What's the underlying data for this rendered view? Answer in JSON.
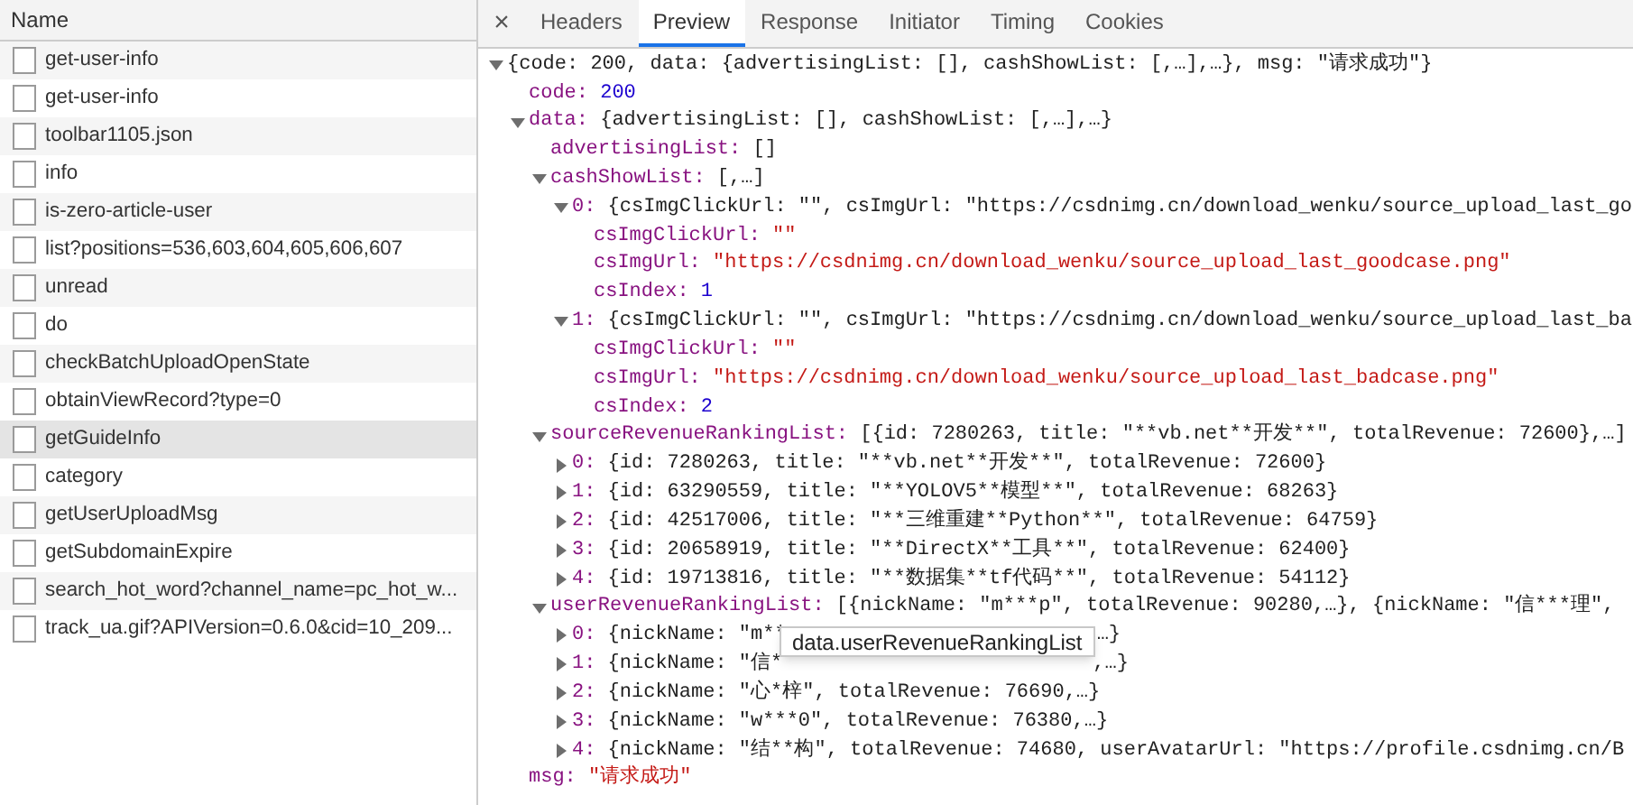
{
  "requests": {
    "column": "Name",
    "rows": [
      {
        "name": "get-user-info",
        "selected": false
      },
      {
        "name": "get-user-info",
        "selected": false
      },
      {
        "name": "toolbar1105.json",
        "selected": false
      },
      {
        "name": "info",
        "selected": false
      },
      {
        "name": "is-zero-article-user",
        "selected": false
      },
      {
        "name": "list?positions=536,603,604,605,606,607",
        "selected": false
      },
      {
        "name": "unread",
        "selected": false
      },
      {
        "name": "do",
        "selected": false
      },
      {
        "name": "checkBatchUploadOpenState",
        "selected": false
      },
      {
        "name": "obtainViewRecord?type=0",
        "selected": false
      },
      {
        "name": "getGuideInfo",
        "selected": true
      },
      {
        "name": "category",
        "selected": false
      },
      {
        "name": "getUserUploadMsg",
        "selected": false
      },
      {
        "name": "getSubdomainExpire",
        "selected": false
      },
      {
        "name": "search_hot_word?channel_name=pc_hot_w...",
        "selected": false
      },
      {
        "name": "track_ua.gif?APIVersion=0.6.0&cid=10_209...",
        "selected": false
      }
    ]
  },
  "close": "×",
  "tabs": [
    {
      "label": "Headers",
      "selected": false
    },
    {
      "label": "Preview",
      "selected": true
    },
    {
      "label": "Response",
      "selected": false
    },
    {
      "label": "Initiator",
      "selected": false
    },
    {
      "label": "Timing",
      "selected": false
    },
    {
      "label": "Cookies",
      "selected": false
    }
  ],
  "preview": {
    "tree": [
      {
        "kind": "object",
        "value": "{code: 200, data: {advertisingList: [], cashShowList: [,…],…}, msg: \"请求成功\"}",
        "expanded": true,
        "children": [
          {
            "key": "code:",
            "kind": "number",
            "value": "200"
          },
          {
            "key": "data:",
            "kind": "object",
            "value": "{advertisingList: [], cashShowList: [,…],…}",
            "expanded": true,
            "children": [
              {
                "key": "advertisingList:",
                "kind": "object",
                "value": "[]"
              },
              {
                "key": "cashShowList:",
                "kind": "object",
                "value": "[,…]",
                "expanded": true,
                "children": [
                  {
                    "key": "0:",
                    "kind": "object",
                    "value": "{csImgClickUrl: \"\", csImgUrl: \"https://csdnimg.cn/download_wenku/source_upload_last_go",
                    "expanded": true,
                    "children": [
                      {
                        "key": "csImgClickUrl:",
                        "kind": "string",
                        "value": "\"\""
                      },
                      {
                        "key": "csImgUrl:",
                        "kind": "string",
                        "value": "\"https://csdnimg.cn/download_wenku/source_upload_last_goodcase.png\""
                      },
                      {
                        "key": "csIndex:",
                        "kind": "number",
                        "value": "1"
                      }
                    ]
                  },
                  {
                    "key": "1:",
                    "kind": "object",
                    "value": "{csImgClickUrl: \"\", csImgUrl: \"https://csdnimg.cn/download_wenku/source_upload_last_ba",
                    "expanded": true,
                    "children": [
                      {
                        "key": "csImgClickUrl:",
                        "kind": "string",
                        "value": "\"\""
                      },
                      {
                        "key": "csImgUrl:",
                        "kind": "string",
                        "value": "\"https://csdnimg.cn/download_wenku/source_upload_last_badcase.png\""
                      },
                      {
                        "key": "csIndex:",
                        "kind": "number",
                        "value": "2"
                      }
                    ]
                  }
                ]
              },
              {
                "key": "sourceRevenueRankingList:",
                "kind": "object",
                "value": "[{id: 7280263, title: \"**vb.net**开发**\", totalRevenue: 72600},…]",
                "expanded": true,
                "children": [
                  {
                    "key": "0:",
                    "kind": "object",
                    "value": "{id: 7280263, title: \"**vb.net**开发**\", totalRevenue: 72600}",
                    "expanded": false
                  },
                  {
                    "key": "1:",
                    "kind": "object",
                    "value": "{id: 63290559, title: \"**YOLOV5**模型**\", totalRevenue: 68263}",
                    "expanded": false
                  },
                  {
                    "key": "2:",
                    "kind": "object",
                    "value": "{id: 42517006, title: \"**三维重建**Python**\", totalRevenue: 64759}",
                    "expanded": false
                  },
                  {
                    "key": "3:",
                    "kind": "object",
                    "value": "{id: 20658919, title: \"**DirectX**工具**\", totalRevenue: 62400}",
                    "expanded": false
                  },
                  {
                    "key": "4:",
                    "kind": "object",
                    "value": "{id: 19713816, title: \"**数据集**tf代码**\", totalRevenue: 54112}",
                    "expanded": false
                  }
                ]
              },
              {
                "key": "userRevenueRankingList:",
                "kind": "object",
                "value": "[{nickName: \"m***p\", totalRevenue: 90280,…}, {nickName: \"信***理\",",
                "expanded": true,
                "children": [
                  {
                    "key": "0:",
                    "kind": "object",
                    "value": "{nickName: \"m**",
                    "tail": "…}",
                    "expanded": false
                  },
                  {
                    "key": "1:",
                    "kind": "object",
                    "value": "{nickName: \"信*",
                    "tail": ",…}",
                    "expanded": false
                  },
                  {
                    "key": "2:",
                    "kind": "object",
                    "value": "{nickName: \"心*梓\", totalRevenue: 76690,…}",
                    "expanded": false
                  },
                  {
                    "key": "3:",
                    "kind": "object",
                    "value": "{nickName: \"w***0\", totalRevenue: 76380,…}",
                    "expanded": false
                  },
                  {
                    "key": "4:",
                    "kind": "object",
                    "value": "{nickName: \"结**构\", totalRevenue: 74680, userAvatarUrl: \"https://profile.csdnimg.cn/B",
                    "expanded": false
                  }
                ]
              }
            ]
          },
          {
            "key": "msg:",
            "kind": "string",
            "value": "\"请求成功\""
          }
        ]
      }
    ],
    "tooltip": "data.userRevenueRankingList"
  }
}
